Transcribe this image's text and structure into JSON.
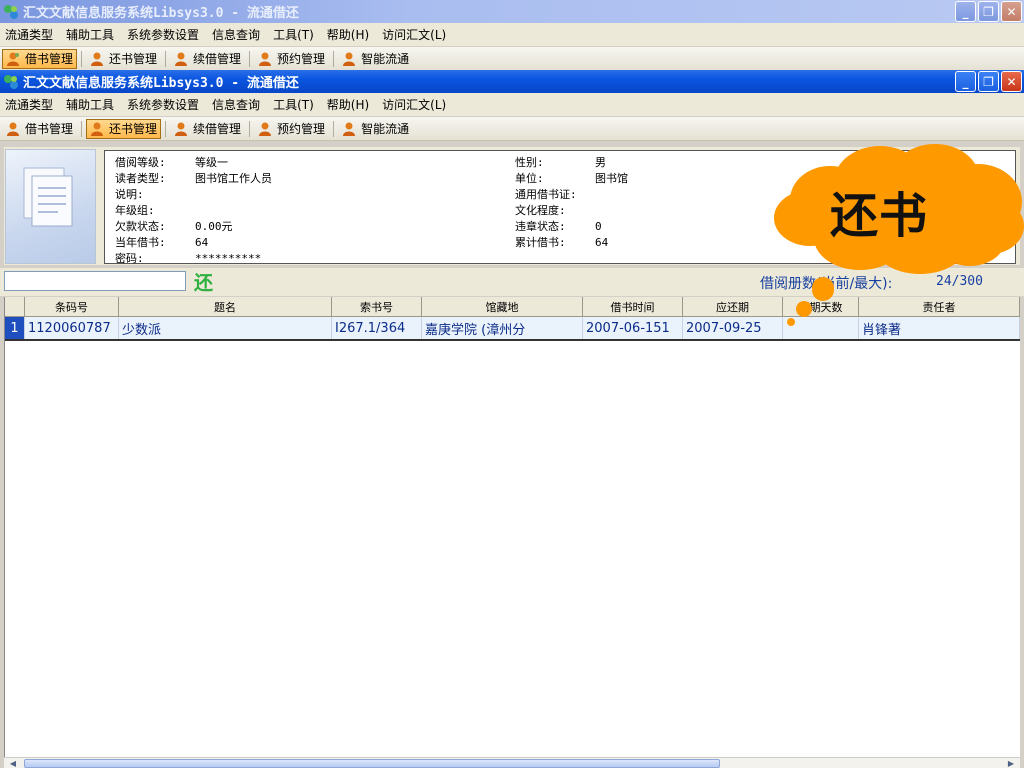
{
  "back_window": {
    "title": "汇文文献信息服务系统Libsys3.0 - 流通借还",
    "menu": [
      "流通类型",
      "辅助工具",
      "系统参数设置",
      "信息查询",
      "工具(T)",
      "帮助(H)",
      "访问汇文(L)"
    ],
    "toolbar": [
      "借书管理",
      "还书管理",
      "续借管理",
      "预约管理",
      "智能流通"
    ]
  },
  "window": {
    "title": "汇文文献信息服务系统Libsys3.0 - 流通借还",
    "menu": [
      "流通类型",
      "辅助工具",
      "系统参数设置",
      "信息查询",
      "工具(T)",
      "帮助(H)",
      "访问汇文(L)"
    ],
    "toolbar": [
      "借书管理",
      "还书管理",
      "续借管理",
      "预约管理",
      "智能流通"
    ],
    "active_tab": "还书管理"
  },
  "reader_info": {
    "left": [
      {
        "label": "借阅等级:",
        "value": "等级一"
      },
      {
        "label": "读者类型:",
        "value": "图书馆工作人员"
      },
      {
        "label": "说明:",
        "value": ""
      },
      {
        "label": "年级组:",
        "value": ""
      },
      {
        "label": "欠款状态:",
        "value": "0.00元"
      },
      {
        "label": "当年借书:",
        "value": "64"
      },
      {
        "label": "密码:",
        "value": "**********"
      }
    ],
    "right": [
      {
        "label": "性别:",
        "value": "男"
      },
      {
        "label": "单位:",
        "value": "图书馆"
      },
      {
        "label": "通用借书证:",
        "value": ""
      },
      {
        "label": "文化程度:",
        "value": ""
      },
      {
        "label": "违章状态:",
        "value": "0"
      },
      {
        "label": "累计借书:",
        "value": "64"
      }
    ]
  },
  "return_bar": {
    "input_value": "",
    "return_glyph": "还",
    "count_label": "借阅册数(当前/最大):",
    "count_value": "24/300"
  },
  "table": {
    "columns": [
      "条码号",
      "题名",
      "索书号",
      "馆藏地",
      "借书时间",
      "应还期",
      "超期天数",
      "责任者"
    ],
    "rows": [
      {
        "num": "1",
        "cells": [
          "1120060787",
          "少数派",
          "I267.1/364",
          "嘉庚学院 (漳州分",
          "2007-06-151",
          "2007-09-25",
          "",
          "肖锋著"
        ]
      }
    ]
  },
  "callout": {
    "text": "还书",
    "color": "#ff9900"
  },
  "colors": {
    "title_active": "#0a55e0",
    "title_inactive": "#7a96df",
    "chrome": "#ece9d8",
    "highlight_button": "#ffb84a",
    "row_text": "#0c2c8a"
  }
}
